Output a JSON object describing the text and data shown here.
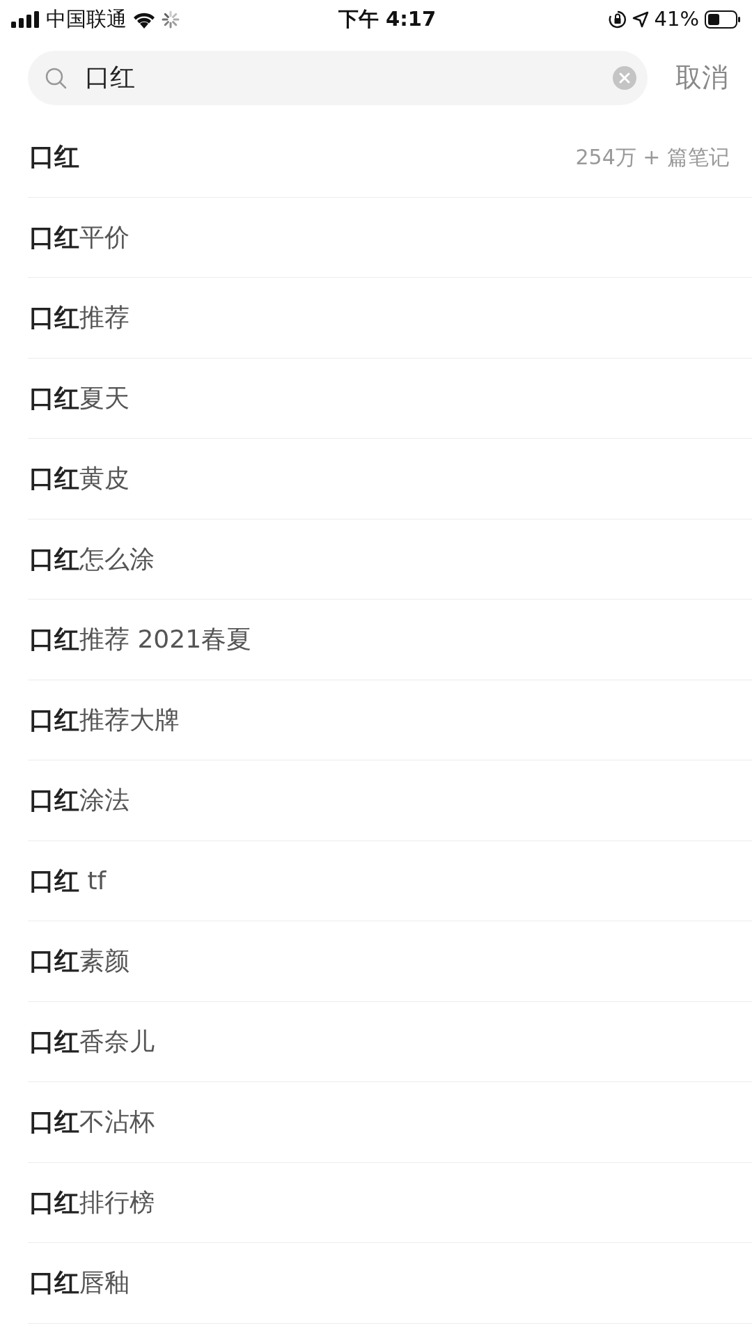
{
  "status_bar": {
    "carrier": "中国联通",
    "time": "下午 4:17",
    "battery": "41%"
  },
  "search": {
    "value": "口红",
    "cancel": "取消"
  },
  "top_result": {
    "query": "口红",
    "count": "254万 + 篇笔记"
  },
  "suggestions": [
    "**口红**平价",
    "**口红**推荐",
    "**口红**夏天",
    "**口红**黄皮",
    "**口红**怎么涂",
    "**口红**推荐 2021春夏",
    "**口红**推荐大牌",
    "**口红**涂法",
    "**口红** tf",
    "**口红**素颜",
    "**口红**香奈儿",
    "**口红**不沾杯",
    "**口红**排行榜",
    "**口红**唇釉"
  ]
}
